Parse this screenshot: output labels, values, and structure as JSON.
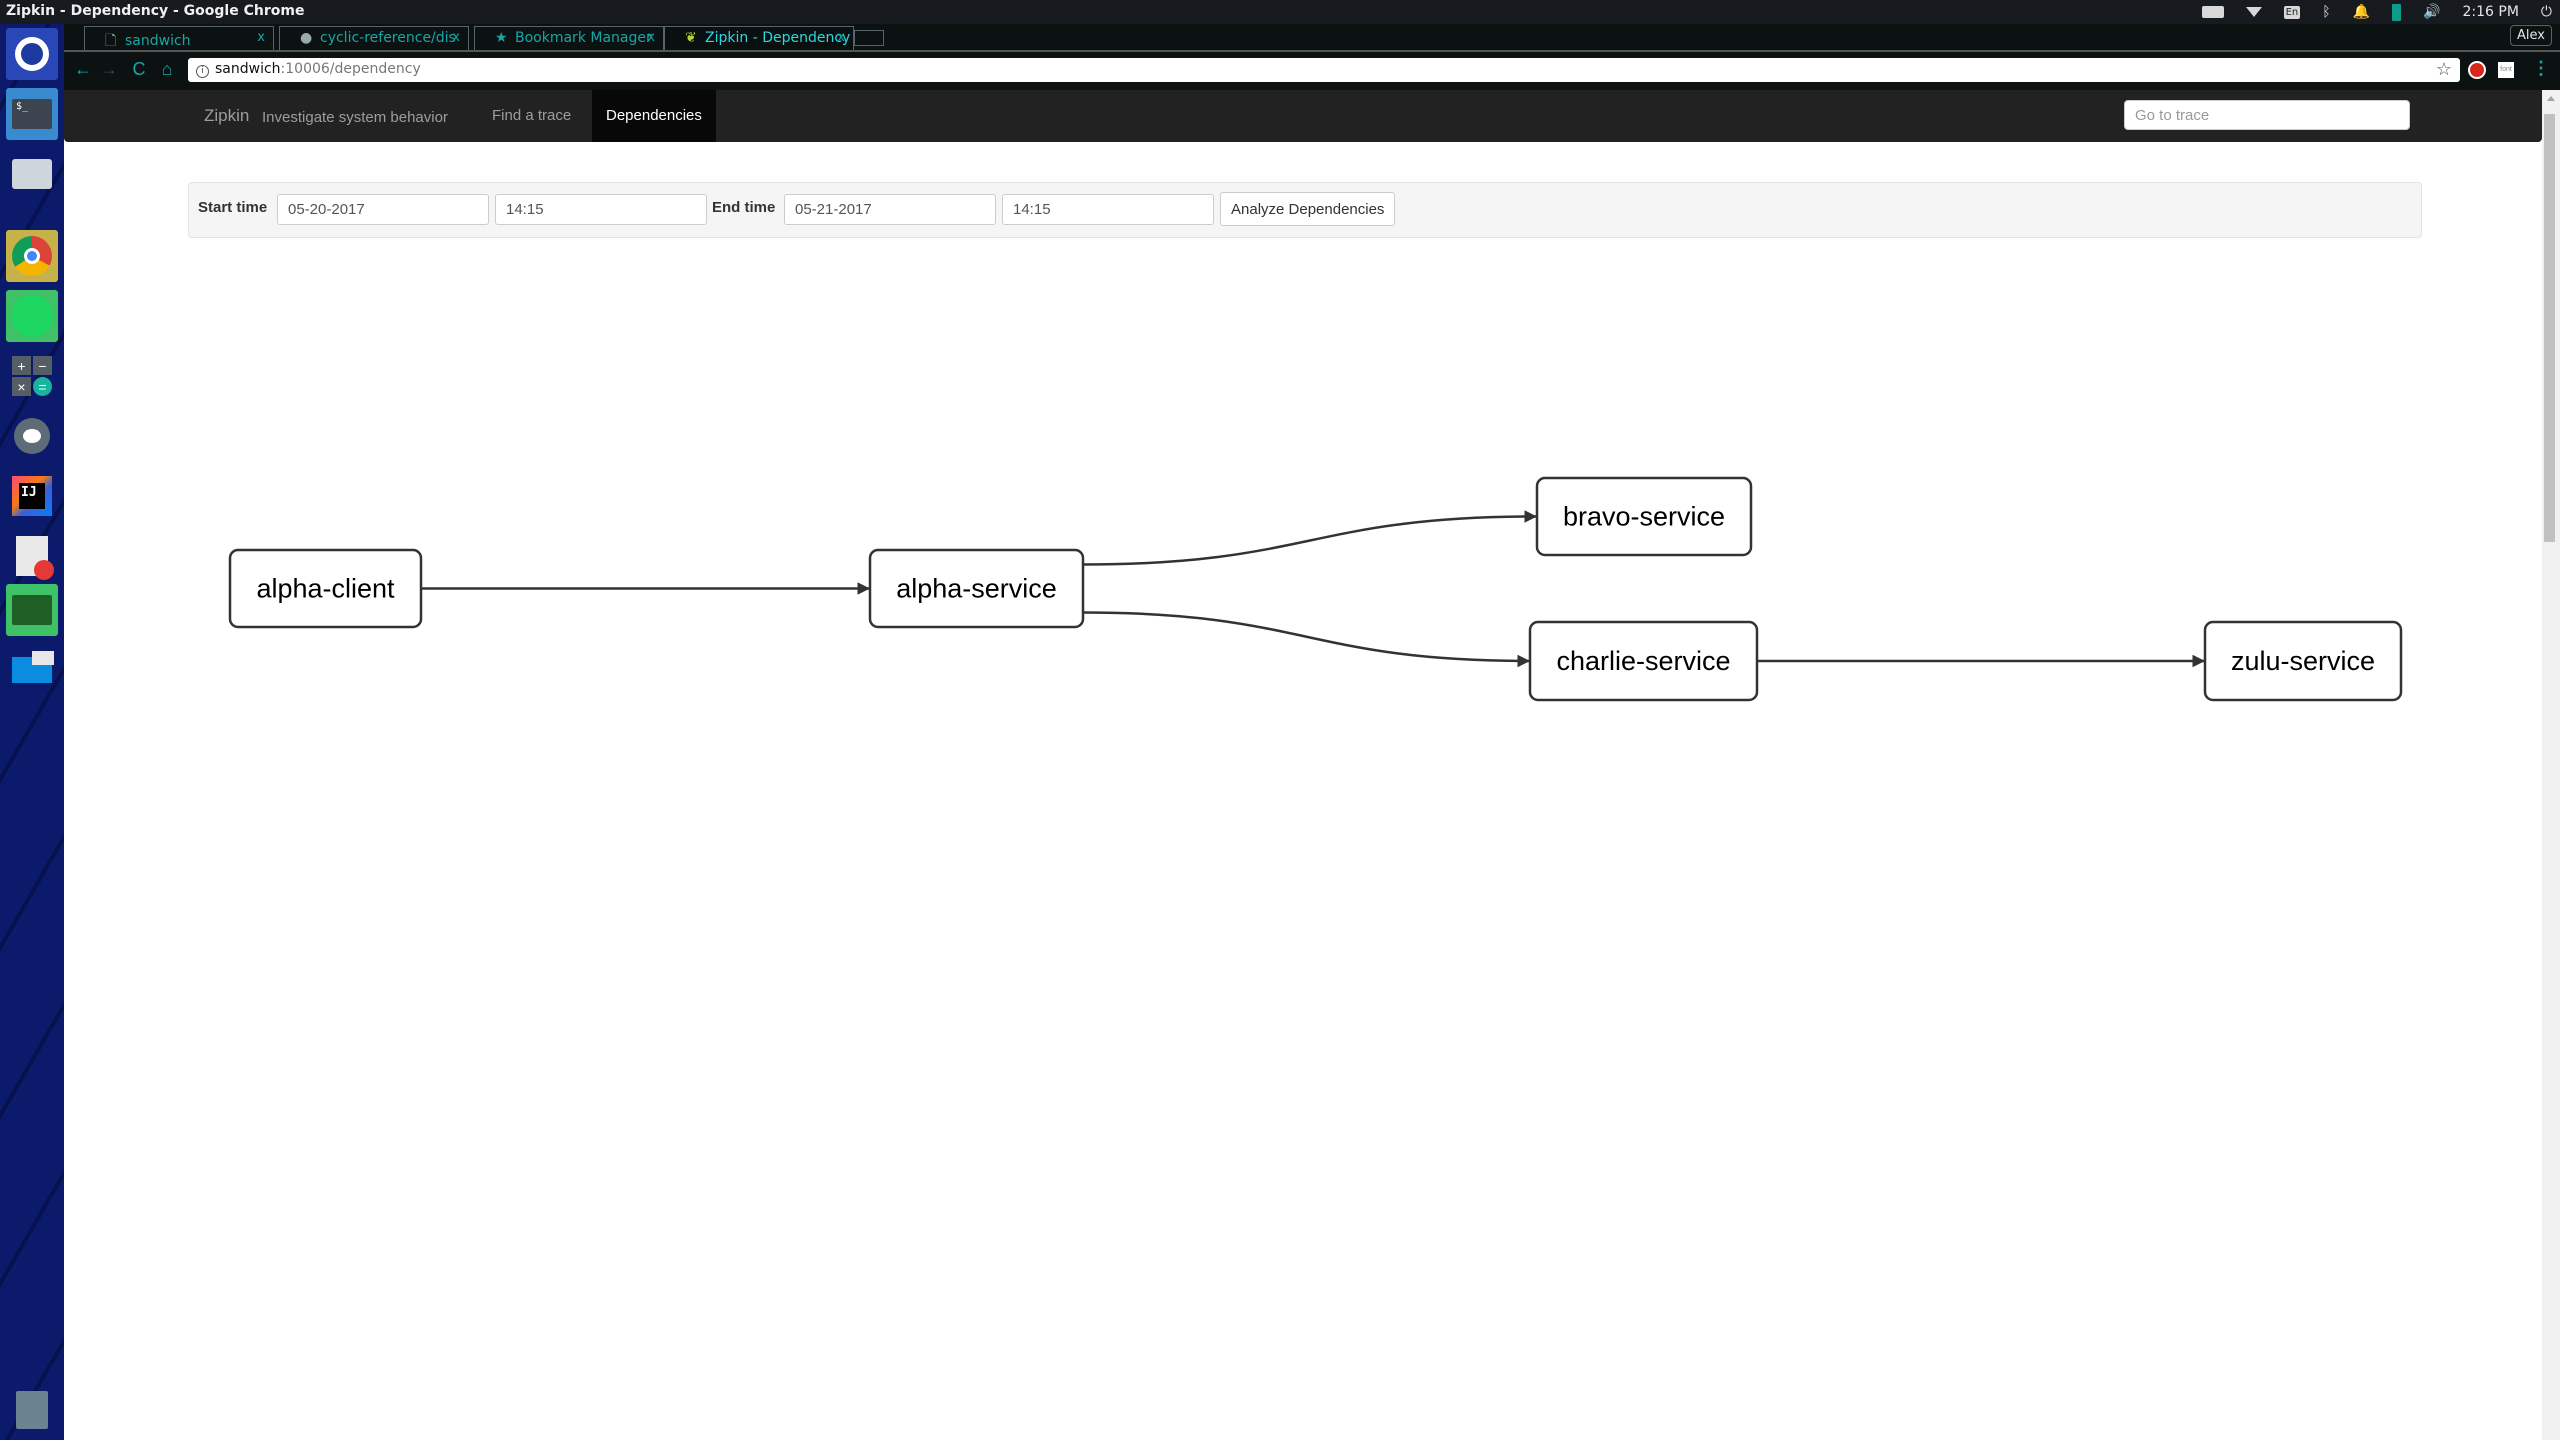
{
  "os": {
    "window_title": "Zipkin - Dependency - Google Chrome",
    "clock": "2:16 PM",
    "user": "Alex",
    "tray_icons": [
      "keyboard-icon",
      "wifi-icon",
      "language-en-icon",
      "bluetooth-icon",
      "bell-icon",
      "battery-icon",
      "volume-icon",
      "power-icon"
    ],
    "language": "En",
    "launcher": [
      "ubuntu-dash",
      "terminal",
      "files",
      "chrome",
      "spotify",
      "calculator",
      "settings",
      "intellij",
      "text-editor",
      "system-monitor",
      "workspaces",
      "trash"
    ]
  },
  "browser": {
    "tabs": [
      {
        "label": "sandwich",
        "icon": "page-icon",
        "active": false
      },
      {
        "label": "cyclic-reference/dis",
        "icon": "github-icon",
        "active": false
      },
      {
        "label": "Bookmark Manager",
        "icon": "star-icon",
        "active": false
      },
      {
        "label": "Zipkin - Dependency",
        "icon": "zipkin-leaf-icon",
        "active": true
      }
    ],
    "close_glyph": "x",
    "url_host": "sandwich",
    "url_path": ":10006/dependency",
    "nav": {
      "back": "←",
      "forward": "→",
      "reload": "C",
      "home": "⌂",
      "star": "☆",
      "menu": "⋮"
    },
    "ext_font_label": "font"
  },
  "zipkin": {
    "brand": "Zipkin",
    "tagline": "Investigate system behavior",
    "nav": {
      "find_trace": "Find a trace",
      "dependencies": "Dependencies"
    },
    "goto_placeholder": "Go to trace",
    "filters": {
      "start_label": "Start time",
      "start_date": "05-20-2017",
      "start_time": "14:15",
      "end_label": "End time",
      "end_date": "05-21-2017",
      "end_time": "14:15",
      "analyze_button": "Analyze Dependencies"
    },
    "graph": {
      "nodes": [
        {
          "id": "alpha-client",
          "label": "alpha-client"
        },
        {
          "id": "alpha-service",
          "label": "alpha-service"
        },
        {
          "id": "bravo-service",
          "label": "bravo-service"
        },
        {
          "id": "charlie-service",
          "label": "charlie-service"
        },
        {
          "id": "zulu-service",
          "label": "zulu-service"
        }
      ],
      "edges": [
        {
          "from": "alpha-client",
          "to": "alpha-service"
        },
        {
          "from": "alpha-service",
          "to": "bravo-service"
        },
        {
          "from": "alpha-service",
          "to": "charlie-service"
        },
        {
          "from": "charlie-service",
          "to": "zulu-service"
        }
      ]
    }
  }
}
